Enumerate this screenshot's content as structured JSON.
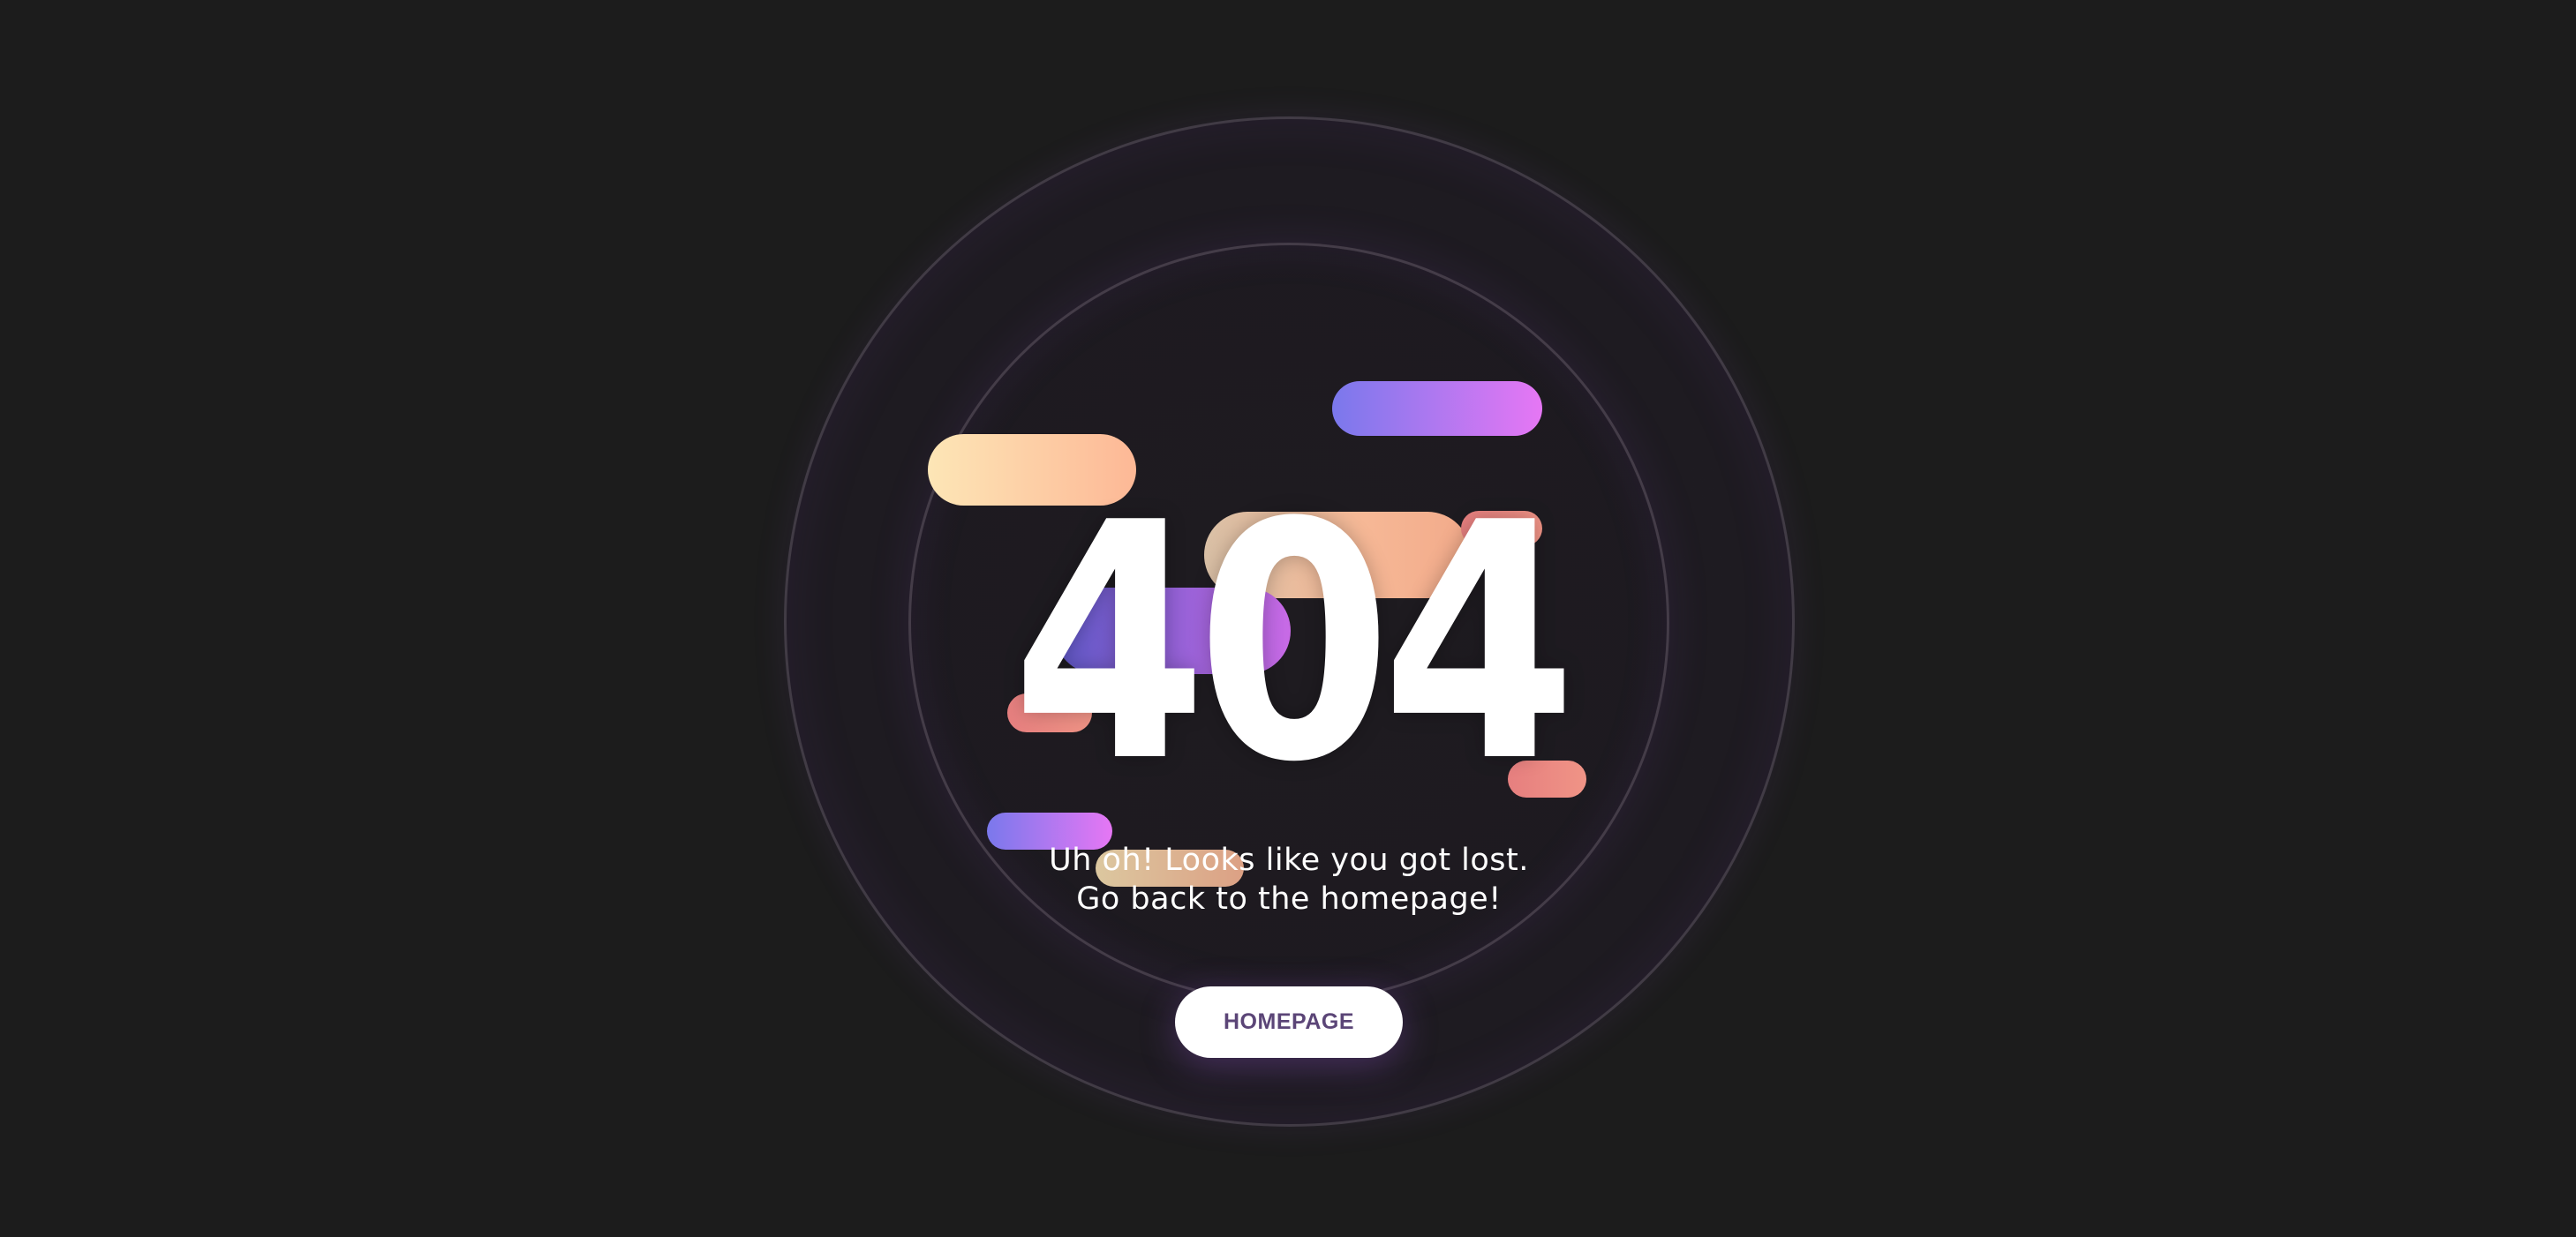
{
  "error_code": "404",
  "message": {
    "line1": "Uh oh! Looks like you got lost.",
    "line2": "Go back to the homepage!"
  },
  "homepage_button": {
    "label": "HOMEPAGE"
  },
  "colors": {
    "background": "#1c1c1c",
    "text": "#ffffff",
    "button_text": "#5b4577",
    "gradient_peach": [
      "#fde6b6",
      "#fdb896"
    ],
    "gradient_purple": [
      "#7a78ec",
      "#e677f4"
    ],
    "gradient_coral": [
      "#e67f7f",
      "#f09486"
    ]
  }
}
